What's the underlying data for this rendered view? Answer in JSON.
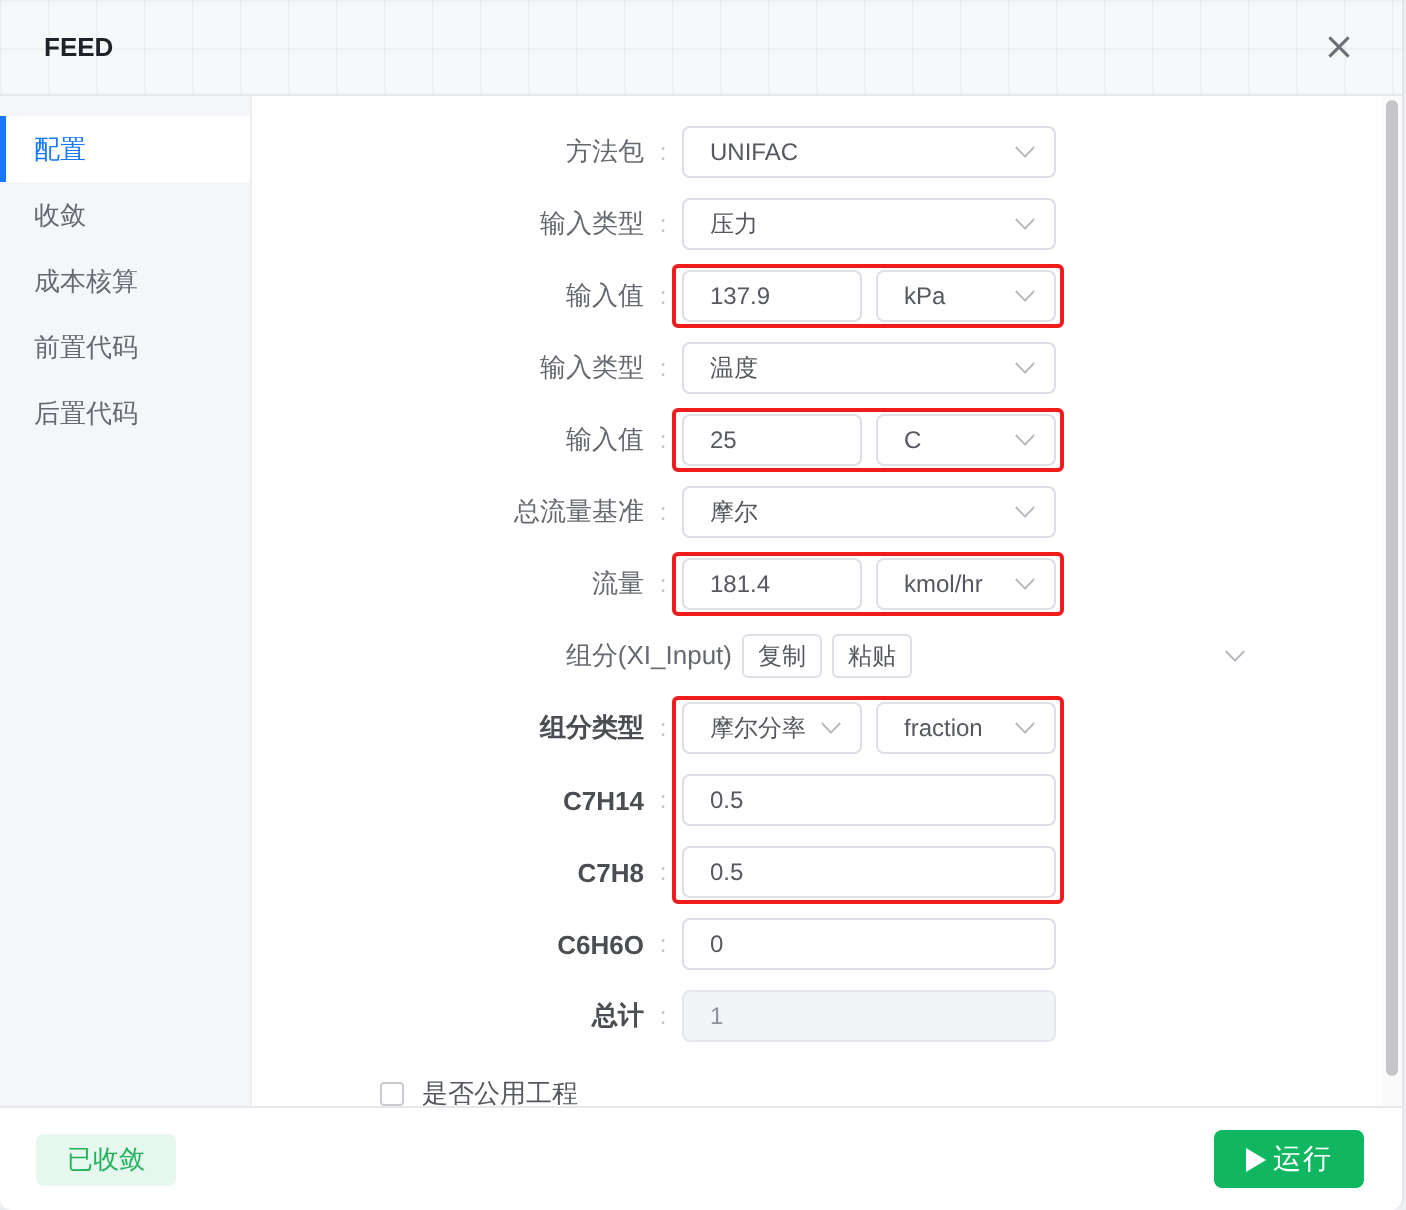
{
  "dialog": {
    "title": "FEED"
  },
  "sidebar": {
    "items": [
      {
        "label": "配置",
        "selected": true
      },
      {
        "label": "收敛",
        "selected": false
      },
      {
        "label": "成本核算",
        "selected": false
      },
      {
        "label": "前置代码",
        "selected": false
      },
      {
        "label": "后置代码",
        "selected": false
      }
    ]
  },
  "form": {
    "groups": [
      {
        "highlighted": false,
        "rows": [
          {
            "kind": "select",
            "label": "方法包",
            "bold": false,
            "colon": ":",
            "value": "UNIFAC"
          },
          {
            "kind": "select",
            "label": "输入类型",
            "bold": false,
            "colon": ":",
            "value": "压力"
          }
        ]
      },
      {
        "highlighted": true,
        "rows": [
          {
            "kind": "input_unit",
            "label": "输入值",
            "bold": false,
            "colon": ":",
            "value": "137.9",
            "unit": "kPa"
          }
        ]
      },
      {
        "highlighted": false,
        "rows": [
          {
            "kind": "select",
            "label": "输入类型",
            "bold": false,
            "colon": ":",
            "value": "温度"
          }
        ]
      },
      {
        "highlighted": true,
        "rows": [
          {
            "kind": "input_unit",
            "label": "输入值",
            "bold": false,
            "colon": ":",
            "value": "25",
            "unit": "C"
          }
        ]
      },
      {
        "highlighted": false,
        "rows": [
          {
            "kind": "select",
            "label": "总流量基准",
            "bold": false,
            "colon": ":",
            "value": "摩尔"
          }
        ]
      },
      {
        "highlighted": true,
        "rows": [
          {
            "kind": "input_unit",
            "label": "流量",
            "bold": false,
            "colon": ":",
            "value": "181.4",
            "unit": "kmol/hr"
          }
        ]
      },
      {
        "highlighted": false,
        "rows": [
          {
            "kind": "buttons",
            "label": "组分(XI_Input)",
            "bold": false,
            "buttons": [
              "复制",
              "粘贴"
            ]
          }
        ]
      },
      {
        "highlighted": true,
        "rows": [
          {
            "kind": "select_pair",
            "label": "组分类型",
            "bold": true,
            "colon": ":",
            "value": "摩尔分率",
            "unit": "fraction"
          },
          {
            "kind": "input",
            "label": "C7H14",
            "bold": true,
            "colon": ":",
            "value": "0.5",
            "disabled": false
          },
          {
            "kind": "input",
            "label": "C7H8",
            "bold": true,
            "colon": ":",
            "value": "0.5",
            "disabled": false
          }
        ]
      },
      {
        "highlighted": false,
        "rows": [
          {
            "kind": "input",
            "label": "C6H6O",
            "bold": true,
            "colon": ":",
            "value": "0",
            "disabled": false
          },
          {
            "kind": "input",
            "label": "总计",
            "bold": true,
            "colon": ":",
            "value": "1",
            "disabled": true
          }
        ]
      }
    ]
  },
  "checkbox": {
    "label": "是否公用工程",
    "checked": false
  },
  "footer": {
    "status": "已收敛",
    "run_label": "运行"
  }
}
